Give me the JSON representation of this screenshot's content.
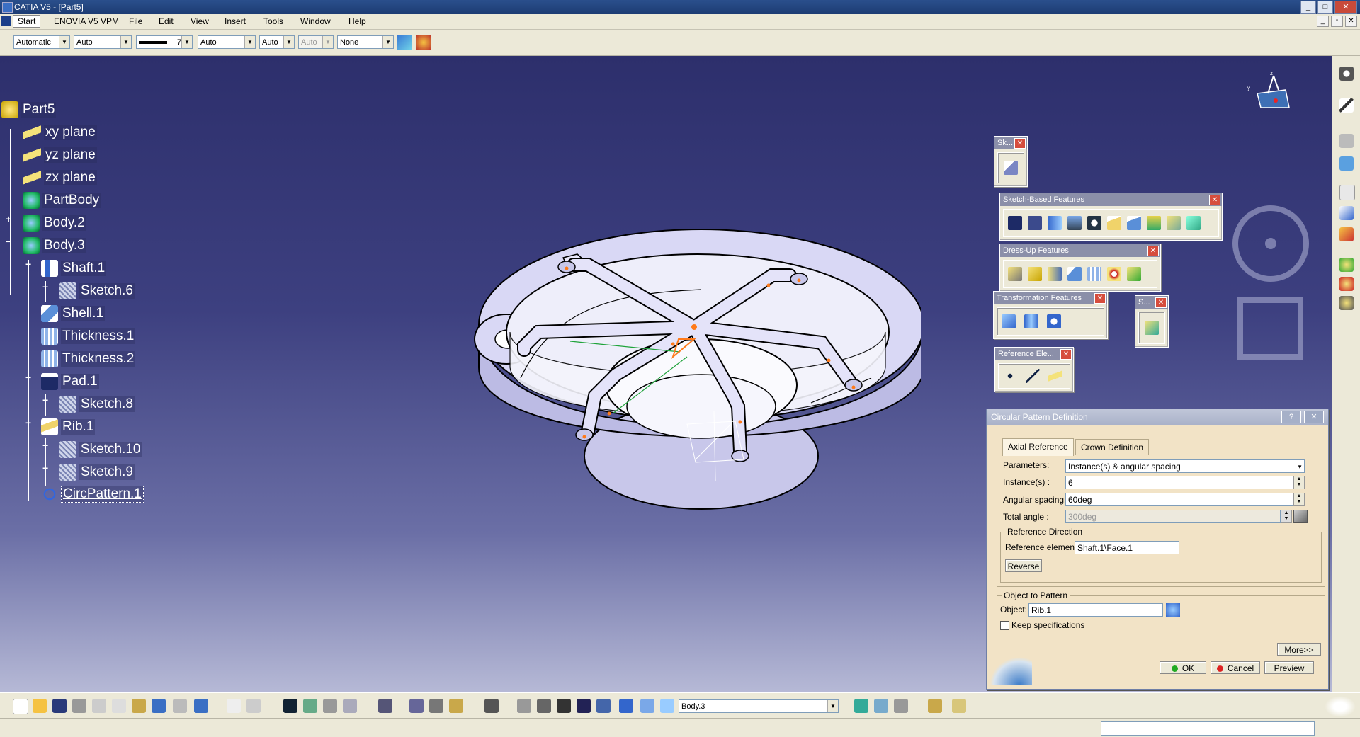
{
  "window": {
    "title": "CATIA V5 - [Part5]",
    "min": "_",
    "max": "□",
    "close": "✕"
  },
  "menu": {
    "items": [
      "Start",
      "ENOVIA V5 VPM",
      "File",
      "Edit",
      "View",
      "Insert",
      "Tools",
      "Window",
      "Help"
    ]
  },
  "properties": {
    "color": "Automatic",
    "transparency": "Auto",
    "linetype_weight": "7",
    "linetype": "Auto",
    "point": "Auto",
    "layer_disabled": "Auto",
    "layer": "None"
  },
  "tree": {
    "root": "Part5",
    "nodes": [
      {
        "label": "xy plane"
      },
      {
        "label": "yz plane"
      },
      {
        "label": "zx plane"
      },
      {
        "label": "PartBody"
      },
      {
        "label": "Body.2"
      },
      {
        "label": "Body.3"
      },
      {
        "label": "Shaft.1"
      },
      {
        "label": "Sketch.6"
      },
      {
        "label": "Shell.1"
      },
      {
        "label": "Thickness.1"
      },
      {
        "label": "Thickness.2"
      },
      {
        "label": "Pad.1"
      },
      {
        "label": "Sketch.8"
      },
      {
        "label": "Rib.1"
      },
      {
        "label": "Sketch.10"
      },
      {
        "label": "Sketch.9"
      },
      {
        "label": "CircPattern.1"
      }
    ]
  },
  "toolbars": {
    "sketcher": "Sk...",
    "sketch_based": "Sketch-Based Features",
    "dress_up": "Dress-Up Features",
    "transformation": "Transformation Features",
    "surface_small": "S...",
    "reference": "Reference Ele...",
    "close": "✕"
  },
  "dialog": {
    "title": "Circular Pattern Definition",
    "help": "?",
    "close": "✕",
    "tabs": [
      "Axial Reference",
      "Crown Definition"
    ],
    "parameters_label": "Parameters:",
    "parameters_value": "Instance(s) & angular spacing",
    "instances_label": "Instance(s) :",
    "instances_value": "6",
    "angular_spacing_label": "Angular spacing :",
    "angular_spacing_value": "60deg",
    "total_angle_label": "Total angle :",
    "total_angle_value": "300deg",
    "ref_direction_title": "Reference Direction",
    "ref_element_label": "Reference element:",
    "ref_element_value": "Shaft.1\\Face.1",
    "reverse": "Reverse",
    "object_group_title": "Object to Pattern",
    "object_label": "Object:",
    "object_value": "Rib.1",
    "keep_specs": "Keep specifications",
    "more": "More>>",
    "ok": "OK",
    "cancel": "Cancel",
    "preview": "Preview"
  },
  "bottom": {
    "current_body": "Body.3"
  },
  "colors": {
    "viewport_top": "#2d2f6c",
    "viewport_bottom": "#b6b9d6",
    "tree_text": "#ffffff",
    "dialog_bg": "#f2e3c6",
    "part_face": "#d9d8f5"
  }
}
